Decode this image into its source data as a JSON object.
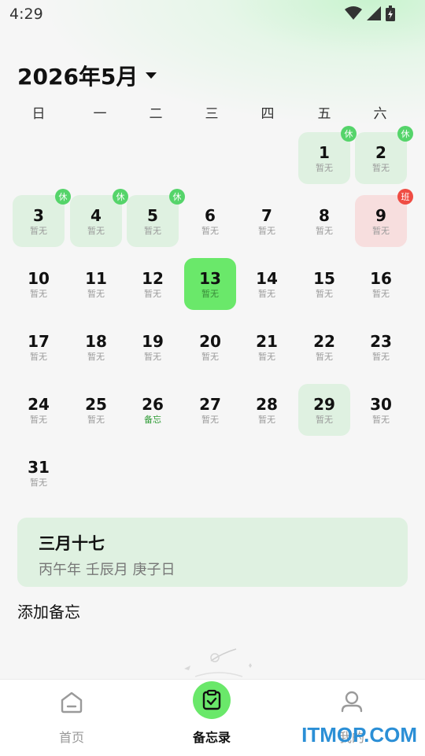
{
  "status_bar": {
    "time": "4:29"
  },
  "header": {
    "month_label": "2026年5月"
  },
  "weekdays": [
    "日",
    "一",
    "二",
    "三",
    "四",
    "五",
    "六"
  ],
  "calendar": {
    "days": [
      {
        "num": "1",
        "sub": "暂无",
        "badge": "休"
      },
      {
        "num": "2",
        "sub": "暂无",
        "badge": "休"
      },
      {
        "num": "3",
        "sub": "暂无",
        "badge": "休"
      },
      {
        "num": "4",
        "sub": "暂无",
        "badge": "休"
      },
      {
        "num": "5",
        "sub": "暂无",
        "badge": "休"
      },
      {
        "num": "6",
        "sub": "暂无"
      },
      {
        "num": "7",
        "sub": "暂无"
      },
      {
        "num": "8",
        "sub": "暂无"
      },
      {
        "num": "9",
        "sub": "暂无",
        "badge": "班"
      },
      {
        "num": "10",
        "sub": "暂无"
      },
      {
        "num": "11",
        "sub": "暂无"
      },
      {
        "num": "12",
        "sub": "暂无"
      },
      {
        "num": "13",
        "sub": "暂无"
      },
      {
        "num": "14",
        "sub": "暂无"
      },
      {
        "num": "15",
        "sub": "暂无"
      },
      {
        "num": "16",
        "sub": "暂无"
      },
      {
        "num": "17",
        "sub": "暂无"
      },
      {
        "num": "18",
        "sub": "暂无"
      },
      {
        "num": "19",
        "sub": "暂无"
      },
      {
        "num": "20",
        "sub": "暂无"
      },
      {
        "num": "21",
        "sub": "暂无"
      },
      {
        "num": "22",
        "sub": "暂无"
      },
      {
        "num": "23",
        "sub": "暂无"
      },
      {
        "num": "24",
        "sub": "暂无"
      },
      {
        "num": "25",
        "sub": "暂无"
      },
      {
        "num": "26",
        "sub": "备忘"
      },
      {
        "num": "27",
        "sub": "暂无"
      },
      {
        "num": "28",
        "sub": "暂无"
      },
      {
        "num": "29",
        "sub": "暂无"
      },
      {
        "num": "30",
        "sub": "暂无"
      },
      {
        "num": "31",
        "sub": "暂无"
      }
    ]
  },
  "lunar": {
    "date": "三月十七",
    "ganzhi": "丙午年 壬辰月 庚子日"
  },
  "memo": {
    "add_label": "添加备忘"
  },
  "nav": {
    "home_label": "首页",
    "memo_label": "备忘录",
    "mine_label": "我的"
  },
  "watermark": "ITMOP.COM",
  "colors": {
    "accent": "#6ae86a",
    "holiday_bg": "#dff1e1",
    "work_bg": "#f7dede",
    "rest_badge": "#55d46a",
    "work_badge": "#ef4c43"
  }
}
